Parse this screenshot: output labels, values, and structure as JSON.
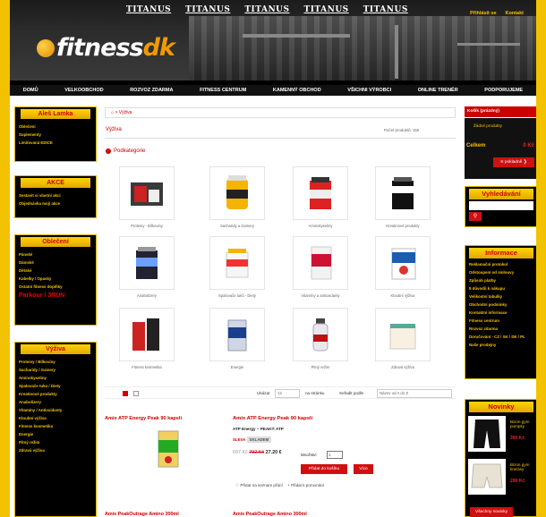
{
  "header": {
    "banner_marks": [
      "TITANUS",
      "TITANUS",
      "TITANUS",
      "TITANUS",
      "TITANUS"
    ],
    "top_links": [
      "Přihlásit se",
      "Kontakt"
    ],
    "logo_main": "fitness",
    "logo_accent": "dk",
    "nav": [
      "DOMŮ",
      "VELKOOBCHOD",
      "ROZVOZ ZDARMA",
      "FITNESS CENTRUM",
      "KAMENNÝ OBCHOD",
      "VŠICHNI VÝROBCI",
      "ONLINE TRENÉR",
      "PODPORUJEME"
    ]
  },
  "left": {
    "user_box": {
      "title": "Aleš Lamka",
      "items": [
        "Oblečení",
        "Suplementy",
        "Limitovaná EDICE"
      ]
    },
    "akce_box": {
      "title": "AKCE",
      "items": [
        "Sestavit si vlastní akci",
        "Objednávka mojí akce"
      ]
    },
    "obleceni_box": {
      "title": "Oblečení",
      "items": [
        "Pánské",
        "Dámské",
        "Dětské",
        "Kabelky / Opasky",
        "Ostatní fitness doplňky"
      ],
      "highlight": "Parkour / 3RUN"
    },
    "vyziva_box": {
      "title": "Výživa",
      "items": [
        "Proteiny / Bílkoviny",
        "Sacharidy / Gainery",
        "Aminokyseliny",
        "Spalovače tuku / Diety",
        "Kreatinové produkty",
        "Anabolizery",
        "Vitamíny / Antioxidanty",
        "Kloubní výživa",
        "Fitness kosmetika",
        "Energie",
        "Pitný režim",
        "Zdravá výživa"
      ]
    }
  },
  "main": {
    "breadcrumb": "Výživa",
    "title": "Výživa",
    "count": "Počet produktů: 156",
    "subcategories_title": "Podkategorie",
    "subcategories": [
      "Proteiny - Bílkoviny",
      "Sacharidy a Gainery",
      "Aminokyseliny",
      "Kreatinové produkty",
      "Anabolizery",
      "Spalovače tuků - Diety",
      "Vitamíny a antioxidanty",
      "Kloubní výživa",
      "Fitness kosmetika",
      "Energie",
      "Pitný režim",
      "Zdravá výživa"
    ],
    "toolbar": {
      "show_label": "Ukázat",
      "show_value": "12",
      "per_page": "na stránku",
      "sort_label": "Seřadit podle",
      "sort_value": "Název od A do Z"
    },
    "left_listing_title": "Amix ATP Energy Peak 90 kapslí",
    "product": {
      "title": "Amix ATP Energy Peak 90 kapslí",
      "subtitle": "ATP Energy – PEAK® ATP",
      "sleva": "SLEVA",
      "stock": "SKLADEM",
      "price_start": "697 Kč",
      "price_old": "792 Kč",
      "price_new": "27.20 €",
      "qty_label": "Množství",
      "qty_value": "1",
      "add_btn": "Přidat do košíku",
      "more_btn": "Více",
      "wishlist": "♡  Přidat na seznam přání",
      "compare": "+  Přidat k porovnání"
    },
    "bottom_cut_1": "Amix PeakOutrage Amino 300ml",
    "bottom_cut_2": "Amix PeakOutrage Amino 300ml"
  },
  "right": {
    "cart": {
      "head": "Košík  (prázdný)",
      "empty": "Žádné produkty",
      "total_label": "Celkem",
      "total_value": "0 Kč",
      "btn": "K pokladně  ❯"
    },
    "search": {
      "title": "Vyhledávání"
    },
    "info": {
      "title": "Informace",
      "items": [
        "Reklamační protokol",
        "Odstoupení od smlouvy",
        "Způsob platby",
        "8 důvodů k nákupu",
        "Velikostní tabulky",
        "Obchodní podmínky",
        "Kontaktní informace",
        "Fitness centrum",
        "Rozvoz zdarma",
        "Doručování - CZ / SK / DE / PL",
        "Naše prodejny"
      ]
    },
    "novinky": {
      "title": "Novinky",
      "items": [
        {
          "name": "Bizon gym pumpky",
          "price": "390 Kč"
        },
        {
          "name": "Bizon gym kraťasy",
          "price": "299 Kč"
        }
      ],
      "btn": "Všechny novinky"
    }
  },
  "colors": {
    "accent": "#c00000",
    "gold": "#f2c200"
  }
}
